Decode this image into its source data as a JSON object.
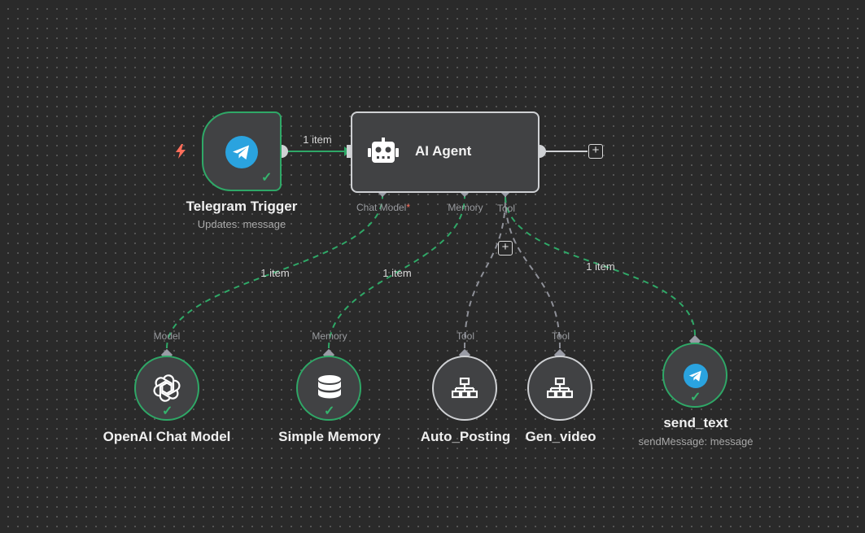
{
  "colors": {
    "canvas": "#2a2a2a",
    "node_fill": "#414244",
    "success": "#2fa867",
    "dashed_main": "#2fa867",
    "dashed_tool": "#8e9098",
    "telegram_blue": "#2aa3df",
    "trigger_bolt": "#ff6d5a"
  },
  "nodes": {
    "telegram_trigger": {
      "title": "Telegram Trigger",
      "subtitle": "Updates: message",
      "icon": "telegram-icon"
    },
    "ai_agent": {
      "title": "AI Agent",
      "icon": "robot-icon"
    },
    "openai_chat_model": {
      "title": "OpenAI Chat Model",
      "port_label": "Model",
      "icon": "openai-icon"
    },
    "simple_memory": {
      "title": "Simple Memory",
      "port_label": "Memory",
      "icon": "database-icon"
    },
    "auto_posting": {
      "title": "Auto_Posting",
      "port_label": "Tool",
      "icon": "network-icon"
    },
    "gen_video": {
      "title": "Gen_video",
      "port_label": "Tool",
      "icon": "network-icon"
    },
    "send_text": {
      "title": "send_text",
      "subtitle": "sendMessage: message",
      "icon": "telegram-icon"
    }
  },
  "agent_ports": {
    "chat_model": "Chat Model",
    "chat_model_required": "*",
    "memory": "Memory",
    "tool": "Tool"
  },
  "edges": {
    "trigger_to_agent": "1 item",
    "model_to_agent": "1 item",
    "memory_to_agent": "1 item",
    "send_text_to_agent": "1 item"
  },
  "buttons": {
    "add_symbol": "+"
  }
}
